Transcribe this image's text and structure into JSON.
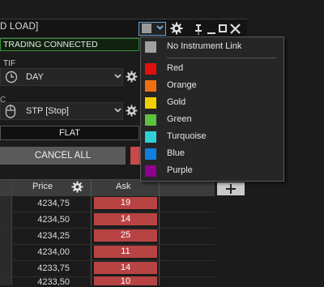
{
  "titlebar": {
    "title": "D LOAD]"
  },
  "status": {
    "text": "TRADING CONNECTED"
  },
  "tif": {
    "label": "TIF",
    "value": "DAY"
  },
  "order_type": {
    "value": "STP [Stop]"
  },
  "side_mark": "C",
  "buttons": {
    "flat": "FLAT",
    "cancel_all": "CANCEL ALL"
  },
  "grid": {
    "headers": {
      "price": "Price",
      "ask": "Ask"
    },
    "rows": [
      {
        "price": "4234,75",
        "ask": "19"
      },
      {
        "price": "4234,50",
        "ask": "14"
      },
      {
        "price": "4234,25",
        "ask": "25"
      },
      {
        "price": "4234,00",
        "ask": "11"
      },
      {
        "price": "4233,75",
        "ask": "14"
      },
      {
        "price": "4233,50",
        "ask": "10"
      }
    ]
  },
  "instrument_link_menu": {
    "items": [
      {
        "label": "No Instrument Link",
        "color": "#a0a0a0"
      },
      {
        "label": "Red",
        "color": "#e01010"
      },
      {
        "label": "Orange",
        "color": "#f07010"
      },
      {
        "label": "Gold",
        "color": "#f0d000"
      },
      {
        "label": "Green",
        "color": "#60c040"
      },
      {
        "label": "Turquoise",
        "color": "#30d0d8"
      },
      {
        "label": "Blue",
        "color": "#1080e0"
      },
      {
        "label": "Purple",
        "color": "#900090"
      }
    ]
  },
  "colors": {
    "accent_border": "#6aa6d8",
    "connected_border": "#3a8d3a",
    "ask_bg": "#b84343"
  },
  "icons": [
    "chevron-down-icon",
    "gear-icon",
    "pin-icon",
    "minimize-icon",
    "maximize-icon",
    "close-icon",
    "clock-icon",
    "mouse-icon",
    "plus-icon"
  ]
}
